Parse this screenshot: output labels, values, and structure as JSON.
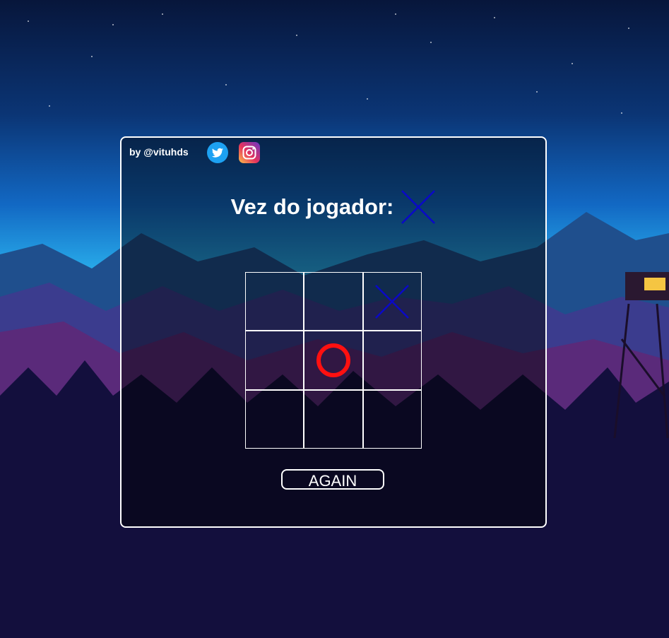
{
  "header": {
    "credits": "by @vituhds",
    "social": [
      {
        "name": "twitter-icon",
        "color": "#1DA1F2"
      },
      {
        "name": "instagram-icon",
        "color": "#E1306C"
      }
    ]
  },
  "turn": {
    "label": "Vez do jogador:",
    "current_player": "X",
    "x_color": "#0a08c8"
  },
  "board": {
    "cells": [
      "",
      "",
      "X",
      "",
      "O",
      "",
      "",
      "",
      ""
    ],
    "o_color": "#ff1010",
    "x_color": "#0a08c8"
  },
  "actions": {
    "again_label": "AGAIN"
  }
}
